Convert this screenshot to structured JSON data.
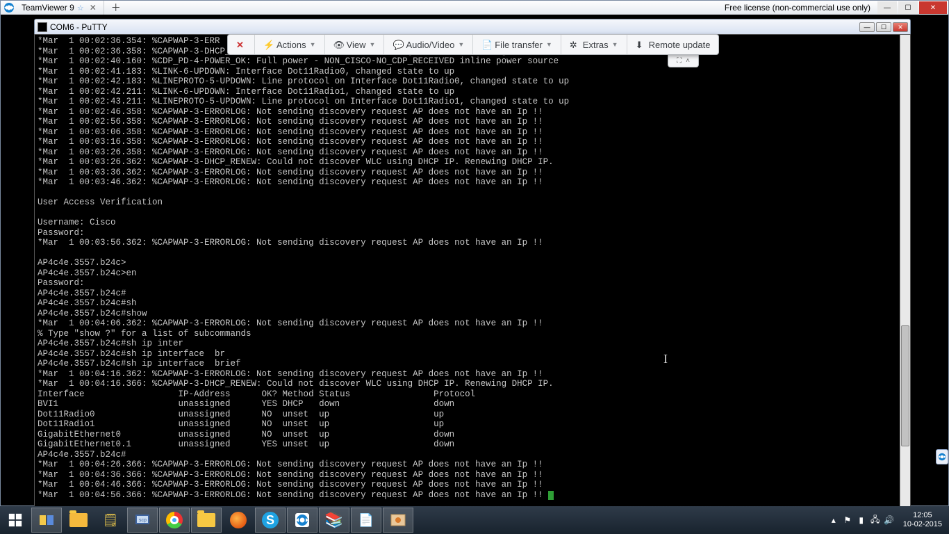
{
  "tv": {
    "tab_title": "TeamViewer 9",
    "free_license": "Free license (non-commercial use only)",
    "toolbar": {
      "actions": "Actions",
      "view": "View",
      "audio_video": "Audio/Video",
      "file_transfer": "File transfer",
      "extras": "Extras",
      "remote_update": "Remote update"
    }
  },
  "putty": {
    "title": "COM6 - PuTTY"
  },
  "terminal_lines": [
    "*Mar  1 00:02:36.354: %CAPWAP-3-ERR",
    "*Mar  1 00:02:36.358: %CAPWAP-3-DHCP_RENEW: Could not discover WLC using DHCP IP. Renewing DHCP IP.",
    "*Mar  1 00:02:40.160: %CDP_PD-4-POWER_OK: Full power - NON_CISCO-NO_CDP_RECEIVED inline power source",
    "*Mar  1 00:02:41.183: %LINK-6-UPDOWN: Interface Dot11Radio0, changed state to up",
    "*Mar  1 00:02:42.183: %LINEPROTO-5-UPDOWN: Line protocol on Interface Dot11Radio0, changed state to up",
    "*Mar  1 00:02:42.211: %LINK-6-UPDOWN: Interface Dot11Radio1, changed state to up",
    "*Mar  1 00:02:43.211: %LINEPROTO-5-UPDOWN: Line protocol on Interface Dot11Radio1, changed state to up",
    "*Mar  1 00:02:46.358: %CAPWAP-3-ERRORLOG: Not sending discovery request AP does not have an Ip !!",
    "*Mar  1 00:02:56.358: %CAPWAP-3-ERRORLOG: Not sending discovery request AP does not have an Ip !!",
    "*Mar  1 00:03:06.358: %CAPWAP-3-ERRORLOG: Not sending discovery request AP does not have an Ip !!",
    "*Mar  1 00:03:16.358: %CAPWAP-3-ERRORLOG: Not sending discovery request AP does not have an Ip !!",
    "*Mar  1 00:03:26.358: %CAPWAP-3-ERRORLOG: Not sending discovery request AP does not have an Ip !!",
    "*Mar  1 00:03:26.362: %CAPWAP-3-DHCP_RENEW: Could not discover WLC using DHCP IP. Renewing DHCP IP.",
    "*Mar  1 00:03:36.362: %CAPWAP-3-ERRORLOG: Not sending discovery request AP does not have an Ip !!",
    "*Mar  1 00:03:46.362: %CAPWAP-3-ERRORLOG: Not sending discovery request AP does not have an Ip !!",
    "",
    "User Access Verification",
    "",
    "Username: Cisco",
    "Password:",
    "*Mar  1 00:03:56.362: %CAPWAP-3-ERRORLOG: Not sending discovery request AP does not have an Ip !!",
    "",
    "AP4c4e.3557.b24c>",
    "AP4c4e.3557.b24c>en",
    "Password:",
    "AP4c4e.3557.b24c#",
    "AP4c4e.3557.b24c#sh",
    "AP4c4e.3557.b24c#show",
    "*Mar  1 00:04:06.362: %CAPWAP-3-ERRORLOG: Not sending discovery request AP does not have an Ip !!",
    "% Type \"show ?\" for a list of subcommands",
    "AP4c4e.3557.b24c#sh ip inter",
    "AP4c4e.3557.b24c#sh ip interface  br",
    "AP4c4e.3557.b24c#sh ip interface  brief",
    "*Mar  1 00:04:16.362: %CAPWAP-3-ERRORLOG: Not sending discovery request AP does not have an Ip !!",
    "*Mar  1 00:04:16.366: %CAPWAP-3-DHCP_RENEW: Could not discover WLC using DHCP IP. Renewing DHCP IP.",
    "Interface                  IP-Address      OK? Method Status                Protocol",
    "BVI1                       unassigned      YES DHCP   down                  down",
    "Dot11Radio0                unassigned      NO  unset  up                    up",
    "Dot11Radio1                unassigned      NO  unset  up                    up",
    "GigabitEthernet0           unassigned      NO  unset  up                    down",
    "GigabitEthernet0.1         unassigned      YES unset  up                    down",
    "AP4c4e.3557.b24c#",
    "*Mar  1 00:04:26.366: %CAPWAP-3-ERRORLOG: Not sending discovery request AP does not have an Ip !!",
    "*Mar  1 00:04:36.366: %CAPWAP-3-ERRORLOG: Not sending discovery request AP does not have an Ip !!",
    "*Mar  1 00:04:46.366: %CAPWAP-3-ERRORLOG: Not sending discovery request AP does not have an Ip !!",
    "*Mar  1 00:04:56.366: %CAPWAP-3-ERRORLOG: Not sending discovery request AP does not have an Ip !! "
  ],
  "taskbar": {
    "time": "12:05",
    "date": "10-02-2015"
  }
}
